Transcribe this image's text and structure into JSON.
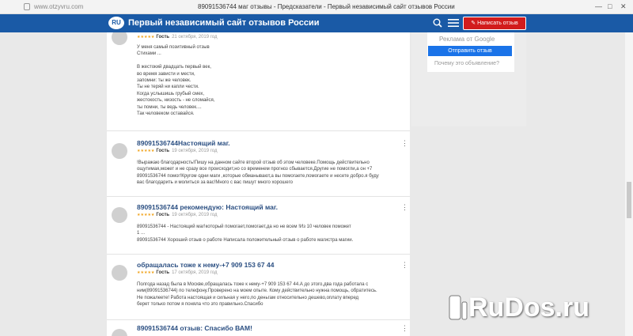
{
  "browser": {
    "url": "www.otzyvru.com",
    "title": "89091536744 маг отзывы - Предсказатели - Первый независимый сайт отзывов России",
    "controls": [
      "—",
      "□",
      "✕"
    ]
  },
  "header": {
    "logo": "RU",
    "site_title": "Первый независимый сайт отзывов России",
    "write_review_label": "Написать отзыв",
    "search_icon": "search-icon",
    "menu_icon": "hamburger-menu-icon"
  },
  "sidebar_ad": {
    "label": "Реклама от Google",
    "send_button": "Отправить отзыв",
    "why_link": "Почему это объявление?"
  },
  "reviews": [
    {
      "title": "",
      "stars": "★★★★★",
      "author": "Гость",
      "date": "21 октября, 2019 год",
      "body": [
        "У меня самый позитивный отзыв",
        "Стихами ...",
        "",
        "В жестокий двадцать первый век,",
        "во время зависти и мести,",
        "запомни: ты же человек.",
        "Ты не теряй ни капли чести.",
        "Когда услышишь грубый смех,",
        "жестокость, низость - не сломайся,",
        "ты помни, ты ведь человек....",
        "Так человеком оставайся."
      ]
    },
    {
      "title": "89091536744Настоящий маг.",
      "stars": "★★★★★",
      "author": "Гость",
      "date": "19 октября, 2019 год",
      "body": [
        "!Выражаю благодарность!Пишу на данном сайте второй отзыв об этом человеке.Помощь действительно",
        "ощутимая,может и не сразу все происходит,но со временем прогноз сбывается.Другие не помогли,а он +7",
        "89091536744 помог!Кругом одни маги ,которые обманывают,а вы помогаете,помогаете и несете добро.я буду",
        "вас благодарить и молиться за вас!Много с вас пишут много хорошего"
      ]
    },
    {
      "title": "89091536744 рекомендую: Настоящий маг.",
      "stars": "★★★★★",
      "author": "Гость",
      "date": "19 октября, 2019 год",
      "body": [
        "89091536744 - Настоящий маг!который помогает,помогает,да но не всем !Из 10 человек поможет",
        "1 ...",
        "89091536744 Хороший отзыв о работе Написала положительный отзыв о работе магистра магии."
      ]
    },
    {
      "title": "обращалась тоже к нему-+7 909 153 67 44",
      "stars": "★★★★★",
      "author": "Гость",
      "date": "17 октября, 2019 год",
      "body": [
        "Полгода назад была в Москве,обращалась тоже к нему-+7 909 153 67 44.А до этого,два года работала с",
        "ним(89091536744) по телефону.Проверено на моем опыте. Кому действительно нужна помощь, обратитесь.",
        "Не пожалеете! Работа настоящая и сильная у него,по деньгам относительно дешево,оплату вперед",
        "берет только потом я поняла что это правильно.Спасибо"
      ]
    },
    {
      "title": "89091536744 отзыв: Спасибо ВАМ!",
      "stars": "",
      "author": "",
      "date": "",
      "body": []
    }
  ],
  "watermark": "RuDos.ru"
}
